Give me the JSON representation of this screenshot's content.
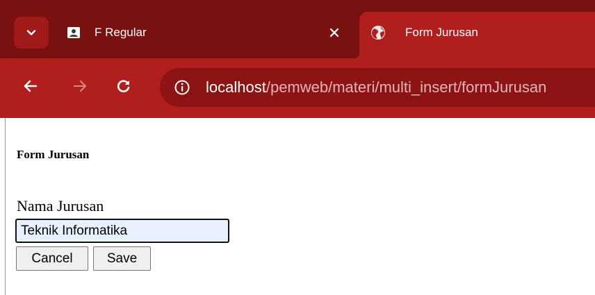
{
  "browser": {
    "tabs": [
      {
        "title": "F Regular",
        "favicon": "contact-card-icon",
        "active": false
      },
      {
        "title": "Form Jurusan",
        "favicon": "globe-icon",
        "active": true
      }
    ],
    "url": {
      "host": "localhost",
      "path": "/pemweb/materi/multi_insert/formJurusan"
    },
    "colors": {
      "frame": "#7a1111",
      "toolbar": "#b11e1e",
      "omnibox": "#8c1414"
    }
  },
  "page": {
    "heading": "Form Jurusan",
    "field": {
      "label": "Nama Jurusan",
      "value": "Teknik Informatika"
    },
    "buttons": {
      "cancel": "Cancel",
      "save": "Save"
    }
  }
}
